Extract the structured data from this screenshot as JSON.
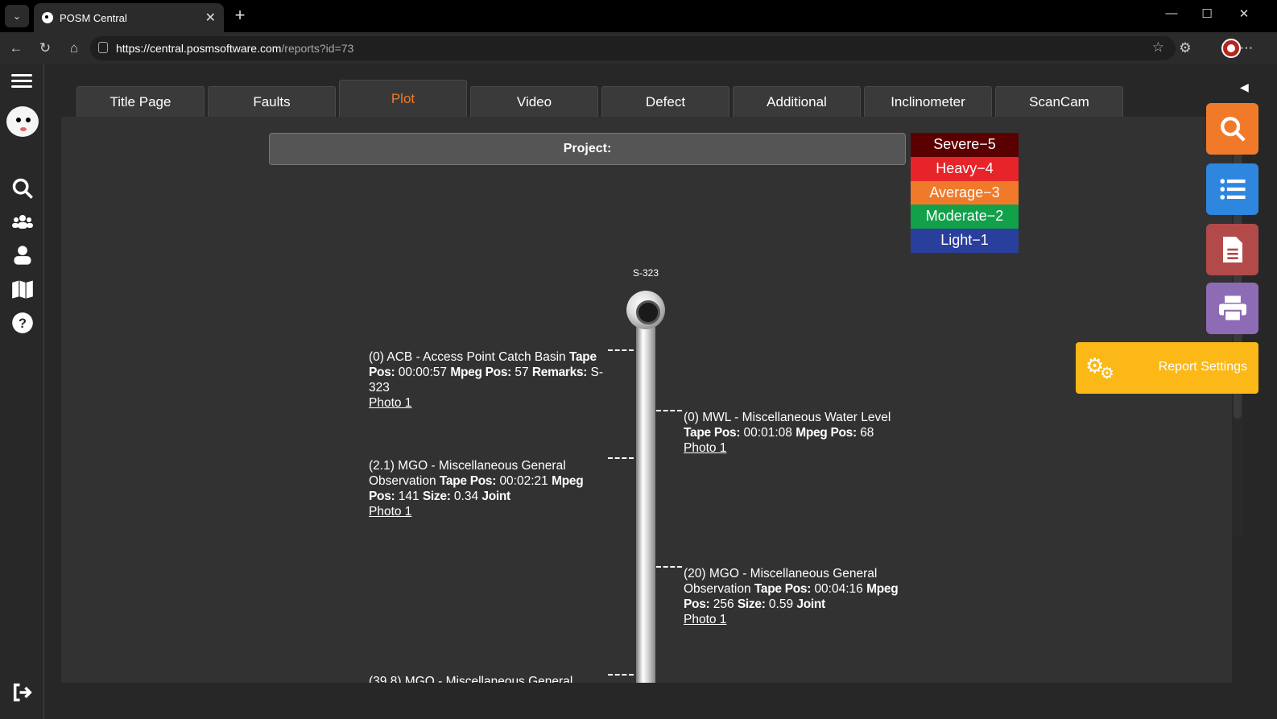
{
  "browser": {
    "tab_title": "POSM Central",
    "url_host": "https://central.posmsoftware.com",
    "url_path": "/reports?id=73"
  },
  "tabs": [
    {
      "label": "Title Page"
    },
    {
      "label": "Faults"
    },
    {
      "label": "Plot",
      "active": true
    },
    {
      "label": "Video"
    },
    {
      "label": "Defect"
    },
    {
      "label": "Additional"
    },
    {
      "label": "Inclinometer"
    },
    {
      "label": "ScanCam"
    }
  ],
  "project": {
    "label": "Project:"
  },
  "legend": [
    {
      "label": "Severe−5",
      "color": "#5a0000"
    },
    {
      "label": "Heavy−4",
      "color": "#e8242b"
    },
    {
      "label": "Average−3",
      "color": "#f07a2a"
    },
    {
      "label": "Moderate−2",
      "color": "#12a04a"
    },
    {
      "label": "Light−1",
      "color": "#2a3f9c"
    }
  ],
  "plot": {
    "node_label": "S-323",
    "left_obs": [
      {
        "title": "(0) ACB - Access Point Catch Basin",
        "tape_label": "Tape Pos:",
        "tape": "00:00:57",
        "mpeg_label": "Mpeg Pos:",
        "mpeg": "57",
        "extra_label": "Remarks:",
        "extra": "S-323",
        "photo": "Photo 1"
      },
      {
        "title": "(2.1) MGO - Miscellaneous General Observation",
        "tape_label": "Tape Pos:",
        "tape": "00:02:21",
        "mpeg_label": "Mpeg Pos:",
        "mpeg": "141",
        "extra_label": "Size:",
        "extra": "0.34",
        "joint": "Joint",
        "photo": "Photo 1"
      },
      {
        "title": "(39.8) MGO - Miscellaneous General"
      }
    ],
    "right_obs": [
      {
        "title": "(0) MWL - Miscellaneous Water Level",
        "tape_label": "Tape Pos:",
        "tape": "00:01:08",
        "mpeg_label": "Mpeg Pos:",
        "mpeg": "68",
        "photo": "Photo 1"
      },
      {
        "title": "(20) MGO - Miscellaneous General Observation",
        "tape_label": "Tape Pos:",
        "tape": "00:04:16",
        "mpeg_label": "Mpeg Pos:",
        "mpeg": "256",
        "extra_label": "Size:",
        "extra": "0.59",
        "joint": "Joint",
        "photo": "Photo 1"
      }
    ]
  },
  "side_actions": {
    "search_color": "#f07a2a",
    "list_color": "#2e86de",
    "doc_color": "#b24a4a",
    "print_color": "#8e6bb5",
    "report_settings_label": "Report Settings",
    "report_settings_color": "#fbb817"
  }
}
